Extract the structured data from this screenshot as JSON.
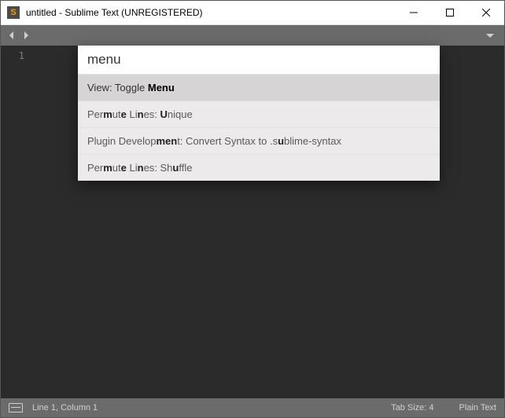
{
  "titlebar": {
    "title": "untitled - Sublime Text (UNREGISTERED)"
  },
  "gutter": {
    "line1": "1"
  },
  "palette": {
    "query": "menu",
    "items": [
      {
        "html": "View: Toggle <b>Menu</b>"
      },
      {
        "html": "Per<b>m</b>ut<b>e</b> Li<b>n</b>es: <b>U</b>nique"
      },
      {
        "html": "Plugin Develop<b>men</b>t: Convert Syntax to .s<b>u</b>blime-syntax"
      },
      {
        "html": "Per<b>m</b>ut<b>e</b> Li<b>n</b>es: Sh<b>u</b>ffle"
      }
    ]
  },
  "statusbar": {
    "position": "Line 1, Column 1",
    "tab_size": "Tab Size: 4",
    "syntax": "Plain Text"
  }
}
